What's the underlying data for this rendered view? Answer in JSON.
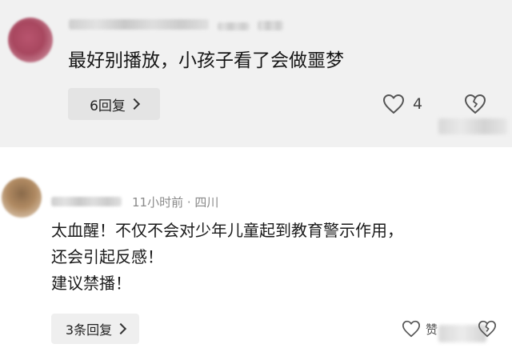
{
  "comments": [
    {
      "text": "最好别播放，小孩子看了会做噩梦",
      "reply_label": "6回复",
      "like_count": "4",
      "icons": {
        "like": "heart-outline-icon",
        "dislike": "broken-heart-icon",
        "reply_more": "chevron-right-icon"
      }
    },
    {
      "meta": "11小时前 · 四川",
      "lines": [
        "太血醒！不仅不会对少年儿童起到教育警示作用，",
        "还会引起反感！",
        "建议禁播！"
      ],
      "reply_label": "3条回复",
      "like_count": "赞",
      "icons": {
        "like": "heart-outline-icon",
        "dislike": "broken-heart-icon",
        "reply_more": "chevron-right-icon"
      }
    }
  ],
  "colors": {
    "highlight_background": "#f1f1f1",
    "text_primary": "#1a1a1a",
    "text_secondary": "#8a8a8a",
    "pill_background": "#e4e4e4"
  }
}
